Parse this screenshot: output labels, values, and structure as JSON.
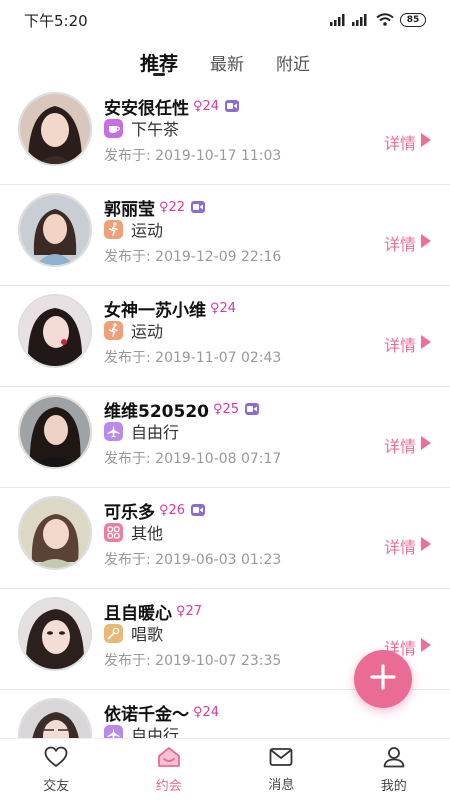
{
  "status": {
    "time": "下午5:20",
    "battery": "85"
  },
  "tabs": [
    {
      "label": "推荐",
      "active": true
    },
    {
      "label": "最新",
      "active": false
    },
    {
      "label": "附近",
      "active": false
    }
  ],
  "posts": [
    {
      "name": "安安很任性",
      "age": "24",
      "gender_symbol": "♀",
      "has_video": true,
      "activity": "下午茶",
      "activity_icon": "teacup-icon",
      "activity_color": "#c56fe0",
      "date_prefix": "发布于:",
      "date": "2019-10-17  11:03",
      "detail_label": "详情"
    },
    {
      "name": "郭丽莹",
      "age": "22",
      "gender_symbol": "♀",
      "has_video": true,
      "activity": "运动",
      "activity_icon": "running-icon",
      "activity_color": "#f0a078",
      "date_prefix": "发布于:",
      "date": "2019-12-09  22:16",
      "detail_label": "详情"
    },
    {
      "name": "女神一苏小维",
      "age": "24",
      "gender_symbol": "♀",
      "has_video": false,
      "activity": "运动",
      "activity_icon": "running-icon",
      "activity_color": "#f0a078",
      "date_prefix": "发布于:",
      "date": "2019-11-07  02:43",
      "detail_label": "详情"
    },
    {
      "name": "维维520520",
      "age": "25",
      "gender_symbol": "♀",
      "has_video": true,
      "activity": "自由行",
      "activity_icon": "plane-icon",
      "activity_color": "#b98be8",
      "date_prefix": "发布于:",
      "date": "2019-10-08  07:17",
      "detail_label": "详情"
    },
    {
      "name": "可乐多",
      "age": "26",
      "gender_symbol": "♀",
      "has_video": true,
      "activity": "其他",
      "activity_icon": "grid-icon",
      "activity_color": "#ee7d9c",
      "date_prefix": "发布于:",
      "date": "2019-06-03  01:23",
      "detail_label": "详情"
    },
    {
      "name": "且自暖心",
      "age": "27",
      "gender_symbol": "♀",
      "has_video": false,
      "activity": "唱歌",
      "activity_icon": "microphone-icon",
      "activity_color": "#e8b876",
      "date_prefix": "发布于:",
      "date": "2019-10-07  23:35",
      "detail_label": "详情"
    },
    {
      "name": "依诺千金～",
      "age": "24",
      "gender_symbol": "♀",
      "has_video": false,
      "activity": "自由行",
      "activity_icon": "plane-icon",
      "activity_color": "#b98be8",
      "date_prefix": "",
      "date": "",
      "detail_label": ""
    }
  ],
  "fab": {
    "icon": "plus-icon"
  },
  "nav": [
    {
      "label": "交友",
      "icon": "heart-icon",
      "active": false
    },
    {
      "label": "约会",
      "icon": "dating-icon",
      "active": true
    },
    {
      "label": "消息",
      "icon": "mail-icon",
      "active": false
    },
    {
      "label": "我的",
      "icon": "user-icon",
      "active": false
    }
  ],
  "colors": {
    "accent": "#ea6b93",
    "gender": "#d53aa4",
    "video": "#8e6bd0"
  }
}
